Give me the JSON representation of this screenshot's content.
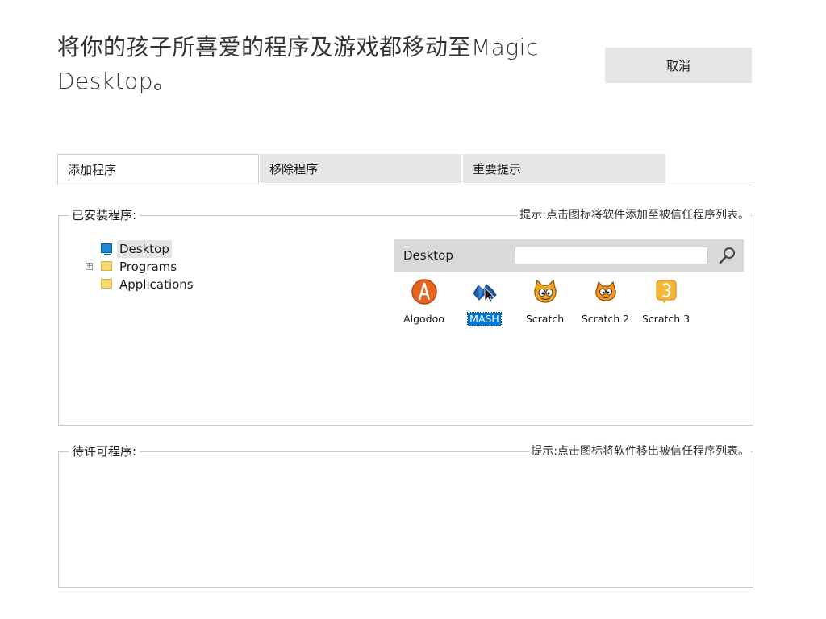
{
  "header": {
    "title": "将你的孩子所喜爱的程序及游戏都移动至Magic Desktop。",
    "cancel_label": "取消"
  },
  "tabs": [
    {
      "label": "添加程序",
      "active": true
    },
    {
      "label": "移除程序",
      "active": false
    },
    {
      "label": "重要提示",
      "active": false
    }
  ],
  "installed": {
    "title": "已安装程序:",
    "hint": "提示:点击图标将软件添加至被信任程序列表。",
    "tree": [
      {
        "label": "Desktop",
        "icon": "desktop-icon",
        "selected": true
      },
      {
        "label": "Programs",
        "icon": "folder-icon",
        "expandable": true
      },
      {
        "label": "Applications",
        "icon": "folder-icon"
      }
    ],
    "browser": {
      "location": "Desktop",
      "search_value": "",
      "apps": [
        {
          "label": "Algodoo",
          "icon": "algodoo-icon"
        },
        {
          "label": "MASH",
          "icon": "mash-icon",
          "selected": true
        },
        {
          "label": "Scratch",
          "icon": "scratch-icon"
        },
        {
          "label": "Scratch 2",
          "icon": "scratch2-icon"
        },
        {
          "label": "Scratch 3",
          "icon": "scratch3-icon"
        }
      ]
    }
  },
  "pending": {
    "title": "待许可程序:",
    "hint": "提示:点击图标将软件移出被信任程序列表。"
  },
  "colors": {
    "tab_inactive": "#e6e6e6",
    "selection": "#0078d7",
    "algodoo": "#e8641e",
    "scratch": "#f5a623",
    "scratch3": "#f7b733"
  }
}
